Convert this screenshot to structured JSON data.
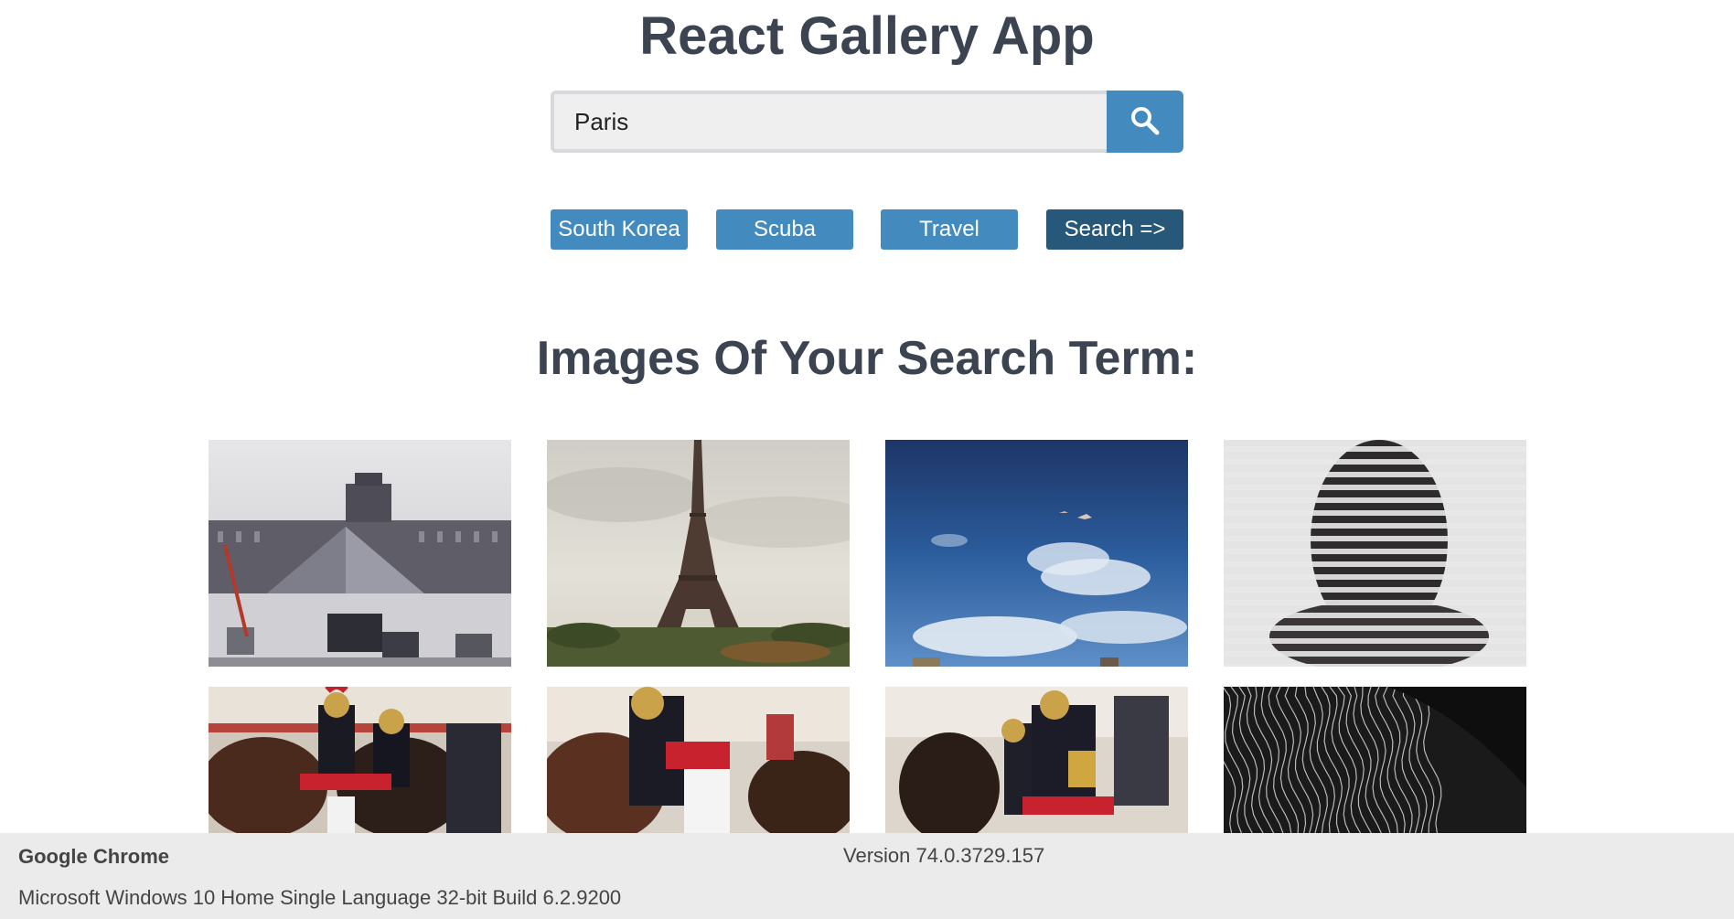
{
  "header": {
    "title": "React Gallery App"
  },
  "search": {
    "value": "Paris",
    "button_icon": "search-icon"
  },
  "nav": {
    "items": [
      {
        "label": "South Korea"
      },
      {
        "label": "Scuba"
      },
      {
        "label": "Travel"
      },
      {
        "label": "Search =>"
      }
    ]
  },
  "results": {
    "title": "Images Of Your Search Term:"
  },
  "photos": [
    {
      "subject": "louvre-pyramid"
    },
    {
      "subject": "eiffel-tower"
    },
    {
      "subject": "blue-sky"
    },
    {
      "subject": "striped-silhouette"
    },
    {
      "subject": "cavalry-horses"
    },
    {
      "subject": "cavalry-horses"
    },
    {
      "subject": "cavalry-horses"
    },
    {
      "subject": "wavy-lines-bw"
    }
  ],
  "footer": {
    "browser": "Google Chrome",
    "version": "Version 74.0.3729.157",
    "os": "Microsoft Windows 10 Home Single Language 32-bit Build 6.2.9200"
  },
  "colors": {
    "accent": "#438bbf",
    "accent_active": "#275779",
    "text": "#3b4450",
    "footer_bg": "#ebebeb"
  }
}
